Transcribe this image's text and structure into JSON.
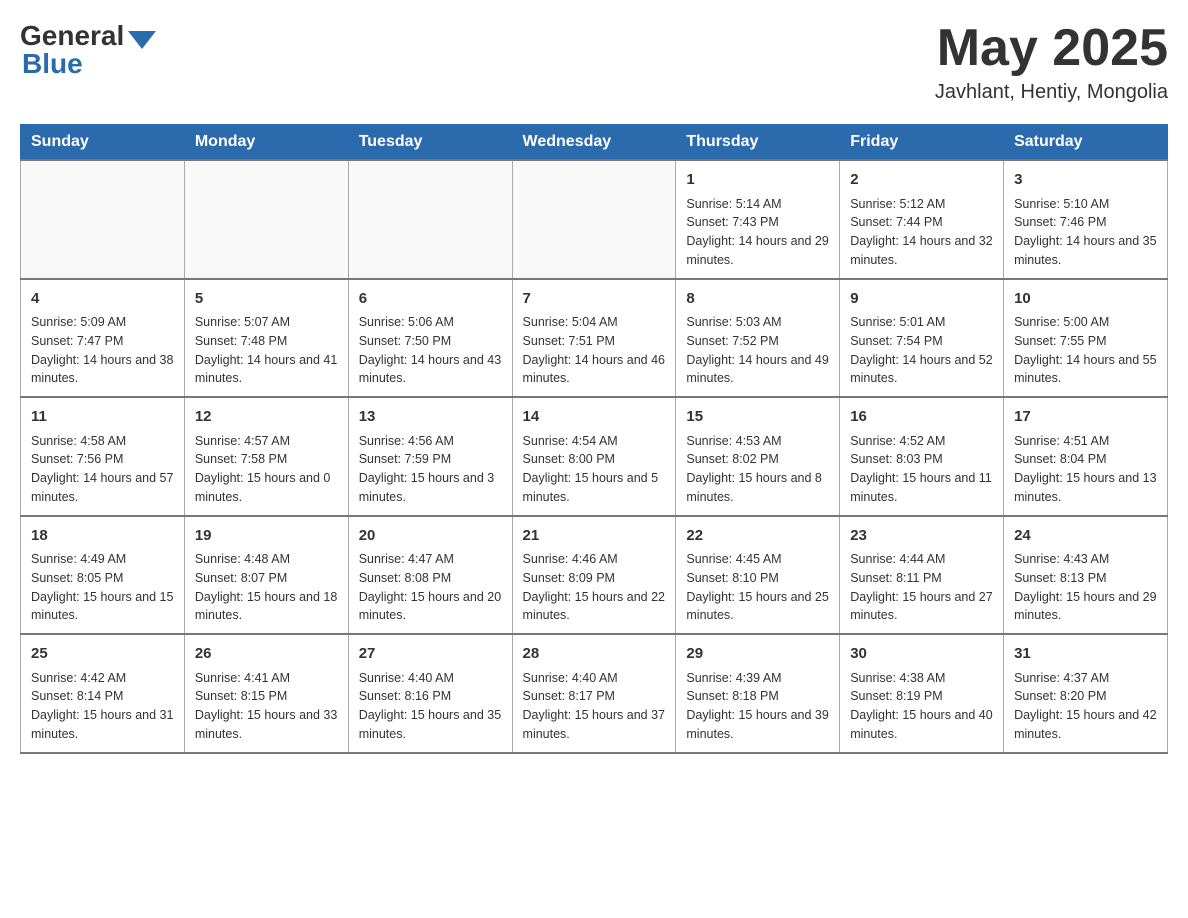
{
  "header": {
    "logo_general": "General",
    "logo_blue": "Blue",
    "month_title": "May 2025",
    "location": "Javhlant, Hentiy, Mongolia"
  },
  "days_of_week": [
    "Sunday",
    "Monday",
    "Tuesday",
    "Wednesday",
    "Thursday",
    "Friday",
    "Saturday"
  ],
  "weeks": [
    [
      {
        "day": "",
        "info": ""
      },
      {
        "day": "",
        "info": ""
      },
      {
        "day": "",
        "info": ""
      },
      {
        "day": "",
        "info": ""
      },
      {
        "day": "1",
        "info": "Sunrise: 5:14 AM\nSunset: 7:43 PM\nDaylight: 14 hours and 29 minutes."
      },
      {
        "day": "2",
        "info": "Sunrise: 5:12 AM\nSunset: 7:44 PM\nDaylight: 14 hours and 32 minutes."
      },
      {
        "day": "3",
        "info": "Sunrise: 5:10 AM\nSunset: 7:46 PM\nDaylight: 14 hours and 35 minutes."
      }
    ],
    [
      {
        "day": "4",
        "info": "Sunrise: 5:09 AM\nSunset: 7:47 PM\nDaylight: 14 hours and 38 minutes."
      },
      {
        "day": "5",
        "info": "Sunrise: 5:07 AM\nSunset: 7:48 PM\nDaylight: 14 hours and 41 minutes."
      },
      {
        "day": "6",
        "info": "Sunrise: 5:06 AM\nSunset: 7:50 PM\nDaylight: 14 hours and 43 minutes."
      },
      {
        "day": "7",
        "info": "Sunrise: 5:04 AM\nSunset: 7:51 PM\nDaylight: 14 hours and 46 minutes."
      },
      {
        "day": "8",
        "info": "Sunrise: 5:03 AM\nSunset: 7:52 PM\nDaylight: 14 hours and 49 minutes."
      },
      {
        "day": "9",
        "info": "Sunrise: 5:01 AM\nSunset: 7:54 PM\nDaylight: 14 hours and 52 minutes."
      },
      {
        "day": "10",
        "info": "Sunrise: 5:00 AM\nSunset: 7:55 PM\nDaylight: 14 hours and 55 minutes."
      }
    ],
    [
      {
        "day": "11",
        "info": "Sunrise: 4:58 AM\nSunset: 7:56 PM\nDaylight: 14 hours and 57 minutes."
      },
      {
        "day": "12",
        "info": "Sunrise: 4:57 AM\nSunset: 7:58 PM\nDaylight: 15 hours and 0 minutes."
      },
      {
        "day": "13",
        "info": "Sunrise: 4:56 AM\nSunset: 7:59 PM\nDaylight: 15 hours and 3 minutes."
      },
      {
        "day": "14",
        "info": "Sunrise: 4:54 AM\nSunset: 8:00 PM\nDaylight: 15 hours and 5 minutes."
      },
      {
        "day": "15",
        "info": "Sunrise: 4:53 AM\nSunset: 8:02 PM\nDaylight: 15 hours and 8 minutes."
      },
      {
        "day": "16",
        "info": "Sunrise: 4:52 AM\nSunset: 8:03 PM\nDaylight: 15 hours and 11 minutes."
      },
      {
        "day": "17",
        "info": "Sunrise: 4:51 AM\nSunset: 8:04 PM\nDaylight: 15 hours and 13 minutes."
      }
    ],
    [
      {
        "day": "18",
        "info": "Sunrise: 4:49 AM\nSunset: 8:05 PM\nDaylight: 15 hours and 15 minutes."
      },
      {
        "day": "19",
        "info": "Sunrise: 4:48 AM\nSunset: 8:07 PM\nDaylight: 15 hours and 18 minutes."
      },
      {
        "day": "20",
        "info": "Sunrise: 4:47 AM\nSunset: 8:08 PM\nDaylight: 15 hours and 20 minutes."
      },
      {
        "day": "21",
        "info": "Sunrise: 4:46 AM\nSunset: 8:09 PM\nDaylight: 15 hours and 22 minutes."
      },
      {
        "day": "22",
        "info": "Sunrise: 4:45 AM\nSunset: 8:10 PM\nDaylight: 15 hours and 25 minutes."
      },
      {
        "day": "23",
        "info": "Sunrise: 4:44 AM\nSunset: 8:11 PM\nDaylight: 15 hours and 27 minutes."
      },
      {
        "day": "24",
        "info": "Sunrise: 4:43 AM\nSunset: 8:13 PM\nDaylight: 15 hours and 29 minutes."
      }
    ],
    [
      {
        "day": "25",
        "info": "Sunrise: 4:42 AM\nSunset: 8:14 PM\nDaylight: 15 hours and 31 minutes."
      },
      {
        "day": "26",
        "info": "Sunrise: 4:41 AM\nSunset: 8:15 PM\nDaylight: 15 hours and 33 minutes."
      },
      {
        "day": "27",
        "info": "Sunrise: 4:40 AM\nSunset: 8:16 PM\nDaylight: 15 hours and 35 minutes."
      },
      {
        "day": "28",
        "info": "Sunrise: 4:40 AM\nSunset: 8:17 PM\nDaylight: 15 hours and 37 minutes."
      },
      {
        "day": "29",
        "info": "Sunrise: 4:39 AM\nSunset: 8:18 PM\nDaylight: 15 hours and 39 minutes."
      },
      {
        "day": "30",
        "info": "Sunrise: 4:38 AM\nSunset: 8:19 PM\nDaylight: 15 hours and 40 minutes."
      },
      {
        "day": "31",
        "info": "Sunrise: 4:37 AM\nSunset: 8:20 PM\nDaylight: 15 hours and 42 minutes."
      }
    ]
  ]
}
